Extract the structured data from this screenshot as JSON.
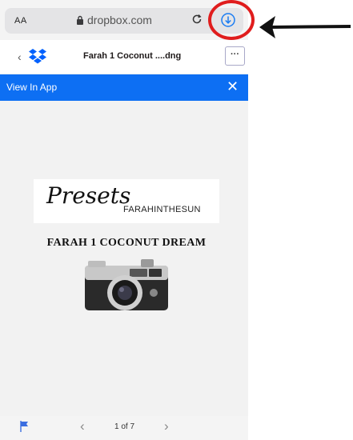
{
  "browser": {
    "text_size_label": "AA",
    "domain": "dropbox.com"
  },
  "header": {
    "back_glyph": "‹",
    "filename": "Farah 1 Coconut ....dng",
    "more_label": "···"
  },
  "banner": {
    "label": "View In App",
    "close_glyph": "✕"
  },
  "document": {
    "presets_word": "Presets",
    "brand": "FARAHINTHESUN",
    "title": "FARAH 1 COCONUT DREAM"
  },
  "pager": {
    "prev_glyph": "‹",
    "page_label": "1 of 7",
    "next_glyph": "›"
  },
  "colors": {
    "banner_blue": "#0d6ff3",
    "annotation_red": "#e01d1d",
    "download_blue": "#1a7cf2"
  },
  "icons": [
    "lock-icon",
    "reload-icon",
    "download-icon",
    "dropbox-logo-icon",
    "flag-icon",
    "camera-image"
  ]
}
